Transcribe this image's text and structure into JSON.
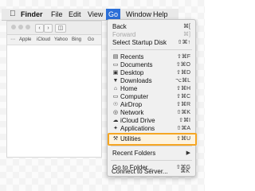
{
  "menubar": {
    "apple_icon": "apple-icon",
    "items": [
      "Finder",
      "File",
      "Edit",
      "View",
      "Go",
      "Window",
      "Help"
    ]
  },
  "window": {
    "favorites": [
      "Apple",
      "iCloud",
      "Yahoo",
      "Bing",
      "Go"
    ]
  },
  "go_menu": {
    "items": [
      {
        "label": "Back",
        "shortcut": "⌘["
      },
      {
        "label": "Forward",
        "shortcut": "⌘]",
        "disabled": true
      },
      {
        "label": "Select Startup Disk",
        "shortcut": "⇧⌘↑"
      },
      {
        "label": "Recents",
        "shortcut": "⇧⌘F",
        "icon": "recents-icon"
      },
      {
        "label": "Documents",
        "shortcut": "⇧⌘O",
        "icon": "documents-icon"
      },
      {
        "label": "Desktop",
        "shortcut": "⇧⌘D",
        "icon": "desktop-icon"
      },
      {
        "label": "Downloads",
        "shortcut": "⌥⌘L",
        "icon": "downloads-icon"
      },
      {
        "label": "Home",
        "shortcut": "⇧⌘H",
        "icon": "home-icon"
      },
      {
        "label": "Computer",
        "shortcut": "⇧⌘C",
        "icon": "computer-icon"
      },
      {
        "label": "AirDrop",
        "shortcut": "⇧⌘R",
        "icon": "airdrop-icon"
      },
      {
        "label": "Network",
        "shortcut": "⇧⌘K",
        "icon": "network-icon"
      },
      {
        "label": "iCloud Drive",
        "shortcut": "⇧⌘I",
        "icon": "icloud-drive-icon"
      },
      {
        "label": "Applications",
        "shortcut": "⇧⌘A",
        "icon": "applications-icon"
      },
      {
        "label": "Utilities",
        "shortcut": "⇧⌘U",
        "icon": "utilities-icon",
        "highlighted": true
      },
      {
        "label": "Recent Folders",
        "shortcut": "▶"
      },
      {
        "label": "Go to Folder...",
        "shortcut": "⇧⌘G"
      },
      {
        "label": "Connect to Server...",
        "shortcut": "⌘K"
      }
    ]
  },
  "colors": {
    "highlight_border": "#f5a623",
    "menu_active": "#2b6fd8"
  }
}
